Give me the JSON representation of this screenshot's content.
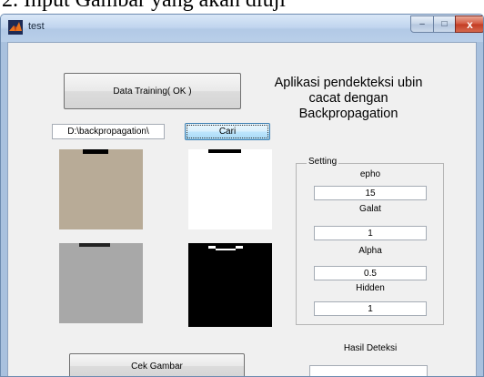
{
  "caption": "2.   Input Gambar yang akan diuji",
  "window": {
    "title": "test",
    "controls": {
      "minimize": "–",
      "maximize": "□",
      "close": "x"
    }
  },
  "buttons": {
    "data_training": "Data Training( OK )",
    "cari": "Cari",
    "cek_gambar": "Cek Gambar"
  },
  "path_field": "D:\\backpropagation\\",
  "heading": [
    "Aplikasi pendekteksi ubin",
    "cacat dengan",
    "Backpropagation"
  ],
  "setting": {
    "title": "Setting",
    "epho_label": "epho",
    "epho_value": "15",
    "galat_label": "Galat",
    "galat_value": "1",
    "alpha_label": "Alpha",
    "alpha_value": "0.5",
    "hidden_label": "Hidden",
    "hidden_value": "1"
  },
  "hasil": {
    "label": "Hasil Deteksi",
    "value": ""
  },
  "colors": {
    "tile": "#b8ab97",
    "gray_tile": "#a8a8a8",
    "client_bg": "#f0f0f0"
  }
}
